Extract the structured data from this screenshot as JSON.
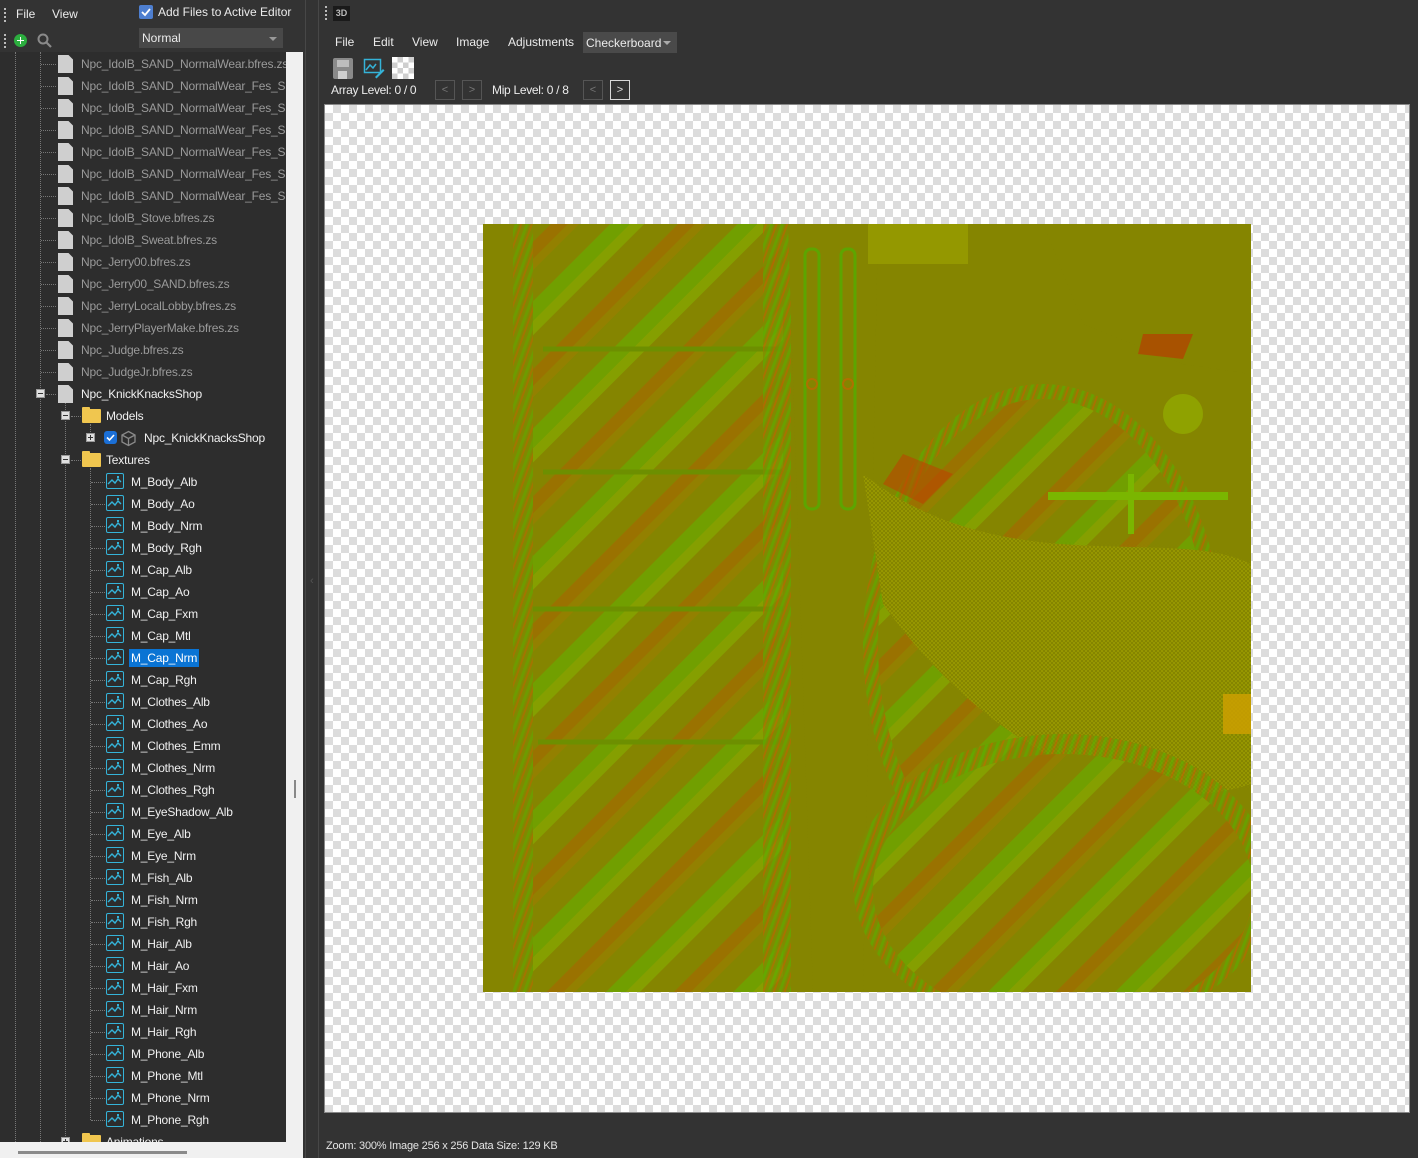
{
  "left_panel": {
    "menu": [
      "File",
      "View"
    ],
    "add_files_to_active_editor": {
      "label": "Add Files to Active Editor",
      "checked": true
    },
    "filter_select": {
      "value": "Normal"
    },
    "tree": {
      "files": [
        "Npc_IdolB_SAND_NormalWear.bfres.zs",
        "Npc_IdolB_SAND_NormalWear_Fes_Sand",
        "Npc_IdolB_SAND_NormalWear_Fes_Sand",
        "Npc_IdolB_SAND_NormalWear_Fes_Sand",
        "Npc_IdolB_SAND_NormalWear_Fes_Sand",
        "Npc_IdolB_SAND_NormalWear_Fes_Sand",
        "Npc_IdolB_SAND_NormalWear_Fes_Sand",
        "Npc_IdolB_Stove.bfres.zs",
        "Npc_IdolB_Sweat.bfres.zs",
        "Npc_Jerry00.bfres.zs",
        "Npc_Jerry00_SAND.bfres.zs",
        "Npc_JerryLocalLobby.bfres.zs",
        "Npc_JerryPlayerMake.bfres.zs",
        "Npc_Judge.bfres.zs",
        "Npc_JudgeJr.bfres.zs"
      ],
      "open_file": "Npc_KnickKnacksShop",
      "models_folder": "Models",
      "model": {
        "name": "Npc_KnickKnacksShop",
        "visible": true
      },
      "textures_folder": "Textures",
      "textures": [
        "M_Body_Alb",
        "M_Body_Ao",
        "M_Body_Nrm",
        "M_Body_Rgh",
        "M_Cap_Alb",
        "M_Cap_Ao",
        "M_Cap_Fxm",
        "M_Cap_Mtl",
        "M_Cap_Nrm",
        "M_Cap_Rgh",
        "M_Clothes_Alb",
        "M_Clothes_Ao",
        "M_Clothes_Emm",
        "M_Clothes_Nrm",
        "M_Clothes_Rgh",
        "M_EyeShadow_Alb",
        "M_Eye_Alb",
        "M_Eye_Nrm",
        "M_Fish_Alb",
        "M_Fish_Nrm",
        "M_Fish_Rgh",
        "M_Hair_Alb",
        "M_Hair_Ao",
        "M_Hair_Fxm",
        "M_Hair_Nrm",
        "M_Hair_Rgh",
        "M_Phone_Alb",
        "M_Phone_Mtl",
        "M_Phone_Nrm",
        "M_Phone_Rgh"
      ],
      "selected_texture": "M_Cap_Nrm",
      "animations_folder": "Animations"
    }
  },
  "editor": {
    "mode_button": "3D",
    "menu": [
      "File",
      "Edit",
      "View",
      "Image",
      "Adjustments"
    ],
    "background_select": {
      "value": "Checkerboard"
    },
    "toolbar_icons": [
      "save-icon",
      "edit-image-icon",
      "alpha-toggle-icon"
    ],
    "array_level": "Array Level: 0 / 0",
    "mip_level": "Mip Level: 0 / 8",
    "nav": {
      "prev": "<",
      "next": ">"
    },
    "status": "Zoom: 300% Image 256 x 256 Data Size: 129 KB"
  },
  "colors": {
    "selection": "#0a74d4",
    "texture_base": "#858500",
    "texture_icon": "#35b3d8",
    "folder": "#f0c64f"
  }
}
